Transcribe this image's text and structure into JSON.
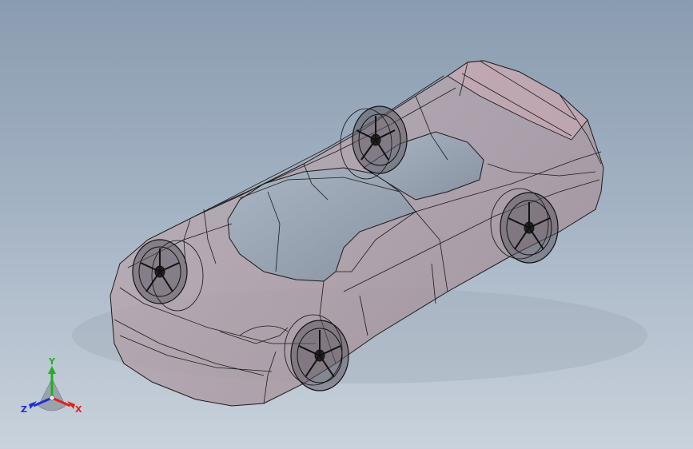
{
  "viewport": {
    "background_top": "#8a9cb0",
    "background_bottom": "#c9d2dc"
  },
  "model": {
    "type": "car-body-wireframe",
    "display_mode": "shaded-with-edges",
    "body_color": "#b9a6b0",
    "edge_color": "#1a1a1a",
    "wheel_count": 4
  },
  "triad": {
    "x_label": "X",
    "y_label": "Y",
    "z_label": "Z",
    "x_color": "#e02020",
    "y_color": "#20b020",
    "z_color": "#2030d0"
  }
}
